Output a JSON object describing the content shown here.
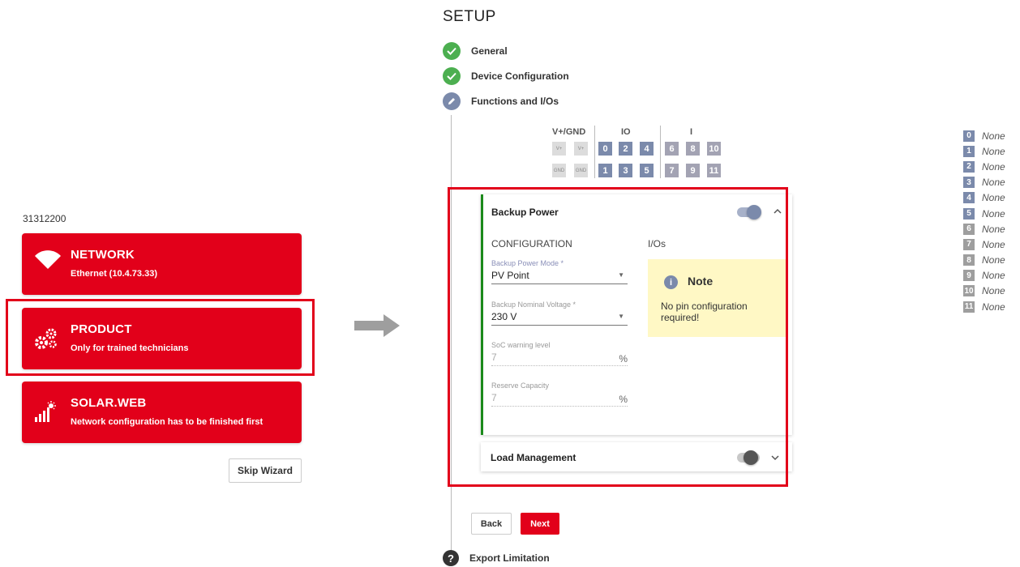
{
  "colors": {
    "brand_red": "#e2001a",
    "success_green": "#4caf50",
    "pin_blue": "#7b8aab",
    "note_yellow": "#fff8c5",
    "active_bar_green": "#1b8a1b"
  },
  "wizard": {
    "serial": "31312200",
    "cards": [
      {
        "title": "NETWORK",
        "subtitle": "Ethernet (10.4.73.33)",
        "icon": "wifi-icon"
      },
      {
        "title": "PRODUCT",
        "subtitle": "Only for trained technicians",
        "icon": "gears-icon"
      },
      {
        "title": "SOLAR.WEB",
        "subtitle": "Network configuration has to be finished first",
        "icon": "solar-chart-icon"
      }
    ],
    "skip_label": "Skip Wizard"
  },
  "setup": {
    "title": "SETUP",
    "steps": [
      {
        "label": "General",
        "state": "done"
      },
      {
        "label": "Device Configuration",
        "state": "done"
      },
      {
        "label": "Functions and I/Os",
        "state": "active"
      },
      {
        "label": "Export Limitation",
        "state": "pending"
      }
    ],
    "pins": {
      "headers": [
        "V+/GND",
        "IO",
        "I"
      ],
      "vplus": "V+",
      "gnd": "GND",
      "io_top": [
        "0",
        "2",
        "4"
      ],
      "io_bottom": [
        "1",
        "3",
        "5"
      ],
      "i_top": [
        "6",
        "8",
        "10"
      ],
      "i_bottom": [
        "7",
        "9",
        "11"
      ]
    },
    "pin_list": [
      {
        "num": "0",
        "value": "None"
      },
      {
        "num": "1",
        "value": "None"
      },
      {
        "num": "2",
        "value": "None"
      },
      {
        "num": "3",
        "value": "None"
      },
      {
        "num": "4",
        "value": "None"
      },
      {
        "num": "5",
        "value": "None"
      },
      {
        "num": "6",
        "value": "None"
      },
      {
        "num": "7",
        "value": "None"
      },
      {
        "num": "8",
        "value": "None"
      },
      {
        "num": "9",
        "value": "None"
      },
      {
        "num": "10",
        "value": "None"
      },
      {
        "num": "11",
        "value": "None"
      }
    ],
    "backup_power": {
      "title": "Backup Power",
      "enabled": true,
      "config_heading": "CONFIGURATION",
      "ios_heading": "I/Os",
      "mode_label": "Backup Power Mode *",
      "mode_value": "PV Point",
      "voltage_label": "Backup Nominal Voltage *",
      "voltage_value": "230 V",
      "soc_label": "SoC warning level",
      "soc_value": "7",
      "reserve_label": "Reserve Capacity",
      "reserve_value": "7",
      "percent_unit": "%",
      "note_title": "Note",
      "note_body": "No pin configuration required!"
    },
    "load_management": {
      "title": "Load Management",
      "enabled": false
    },
    "back_label": "Back",
    "next_label": "Next"
  }
}
